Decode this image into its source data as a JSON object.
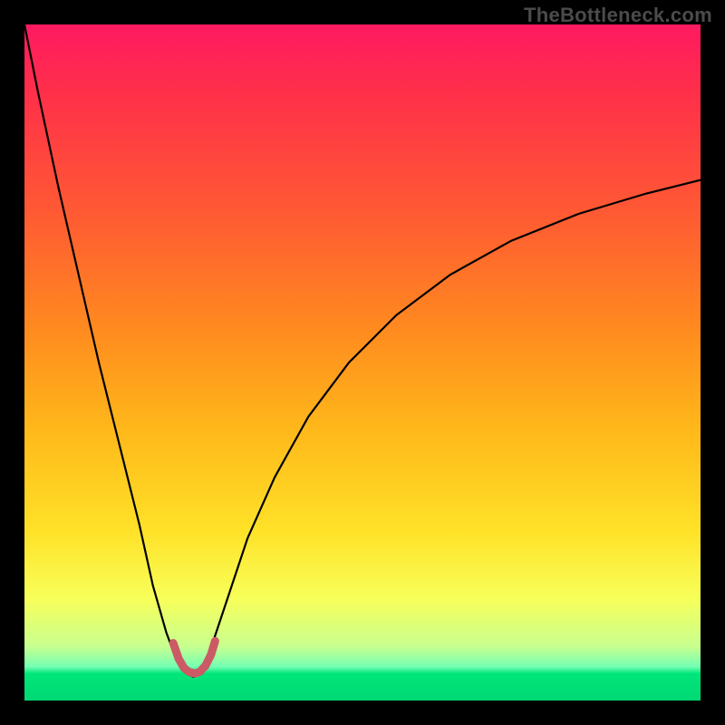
{
  "watermark": "TheBottleneck.com",
  "chart_data": {
    "type": "line",
    "title": "",
    "xlabel": "",
    "ylabel": "",
    "xlim": [
      0,
      100
    ],
    "ylim": [
      0,
      100
    ],
    "grid": false,
    "legend": false,
    "background_gradient_stops": [
      {
        "pos": 0,
        "color": "#ff1a61"
      },
      {
        "pos": 10,
        "color": "#ff2f4a"
      },
      {
        "pos": 28,
        "color": "#ff5a33"
      },
      {
        "pos": 45,
        "color": "#ff8a1f"
      },
      {
        "pos": 60,
        "color": "#ffb81a"
      },
      {
        "pos": 75,
        "color": "#ffe228"
      },
      {
        "pos": 85,
        "color": "#f7ff5a"
      },
      {
        "pos": 92,
        "color": "#c8ff8f"
      },
      {
        "pos": 95,
        "color": "#74ffb3"
      },
      {
        "pos": 96,
        "color": "#00e67a"
      },
      {
        "pos": 100,
        "color": "#00d873"
      }
    ],
    "series": [
      {
        "name": "bottleneck-curve",
        "stroke": "#000000",
        "stroke_width": 2.2,
        "x": [
          0,
          2,
          5,
          8,
          11,
          14,
          17,
          19,
          21,
          22.5,
          24,
          25,
          26,
          27,
          28,
          30,
          33,
          37,
          42,
          48,
          55,
          63,
          72,
          82,
          92,
          100
        ],
        "y": [
          100,
          90,
          76,
          63,
          50,
          38,
          26,
          17,
          10,
          6,
          4,
          3.5,
          4,
          6,
          9,
          15,
          24,
          33,
          42,
          50,
          57,
          63,
          68,
          72,
          75,
          77
        ]
      },
      {
        "name": "valley-highlight",
        "stroke": "#cc5a66",
        "stroke_width": 9,
        "linecap": "round",
        "x": [
          22,
          22.8,
          23.6,
          24.4,
          25.2,
          26,
          26.8,
          27.6,
          28.2
        ],
        "y": [
          8.5,
          6.2,
          4.8,
          4.2,
          4.0,
          4.3,
          5.2,
          6.8,
          8.8
        ]
      }
    ],
    "notes": "Axes are unlabeled in the source image; x and y are normalized 0–100. y=0 at bottom (green), y=100 at top (red). Valley minimum ≈ (25, 3.5)."
  }
}
